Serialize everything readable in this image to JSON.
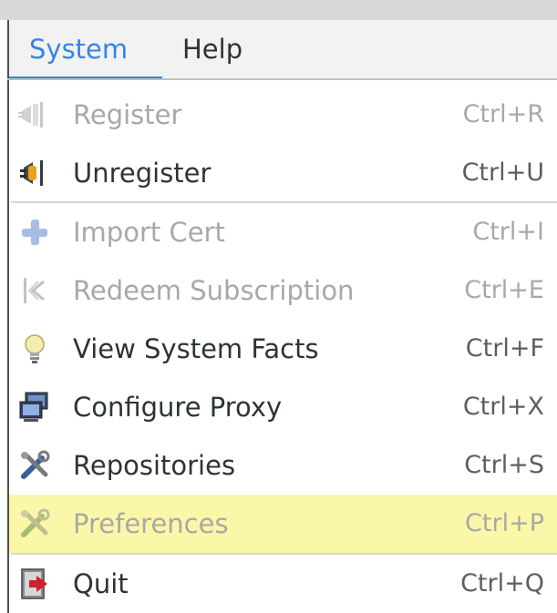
{
  "menubar": {
    "items": [
      {
        "label": "System"
      },
      {
        "label": "Help"
      }
    ]
  },
  "menu": {
    "items": [
      {
        "label": "Register",
        "accel": "Ctrl+R",
        "icon": "register-icon",
        "enabled": false
      },
      {
        "label": "Unregister",
        "accel": "Ctrl+U",
        "icon": "unregister-icon",
        "enabled": true
      },
      {
        "label": "Import Cert",
        "accel": "Ctrl+I",
        "icon": "plus-icon",
        "enabled": false
      },
      {
        "label": "Redeem Subscription",
        "accel": "Ctrl+E",
        "icon": "redeem-icon",
        "enabled": false
      },
      {
        "label": "View System Facts",
        "accel": "Ctrl+F",
        "icon": "lightbulb-icon",
        "enabled": true
      },
      {
        "label": "Configure Proxy",
        "accel": "Ctrl+X",
        "icon": "monitor-network-icon",
        "enabled": true
      },
      {
        "label": "Repositories",
        "accel": "Ctrl+S",
        "icon": "tools-icon",
        "enabled": true
      },
      {
        "label": "Preferences",
        "accel": "Ctrl+P",
        "icon": "tools-icon",
        "enabled": false,
        "highlighted": true
      },
      {
        "label": "Quit",
        "accel": "Ctrl+Q",
        "icon": "exit-icon",
        "enabled": true
      }
    ]
  },
  "colors": {
    "accent": "#3584e4",
    "highlight": "#faf7a8",
    "disabled_text": "#a8a8a8",
    "text": "#2e3436"
  }
}
